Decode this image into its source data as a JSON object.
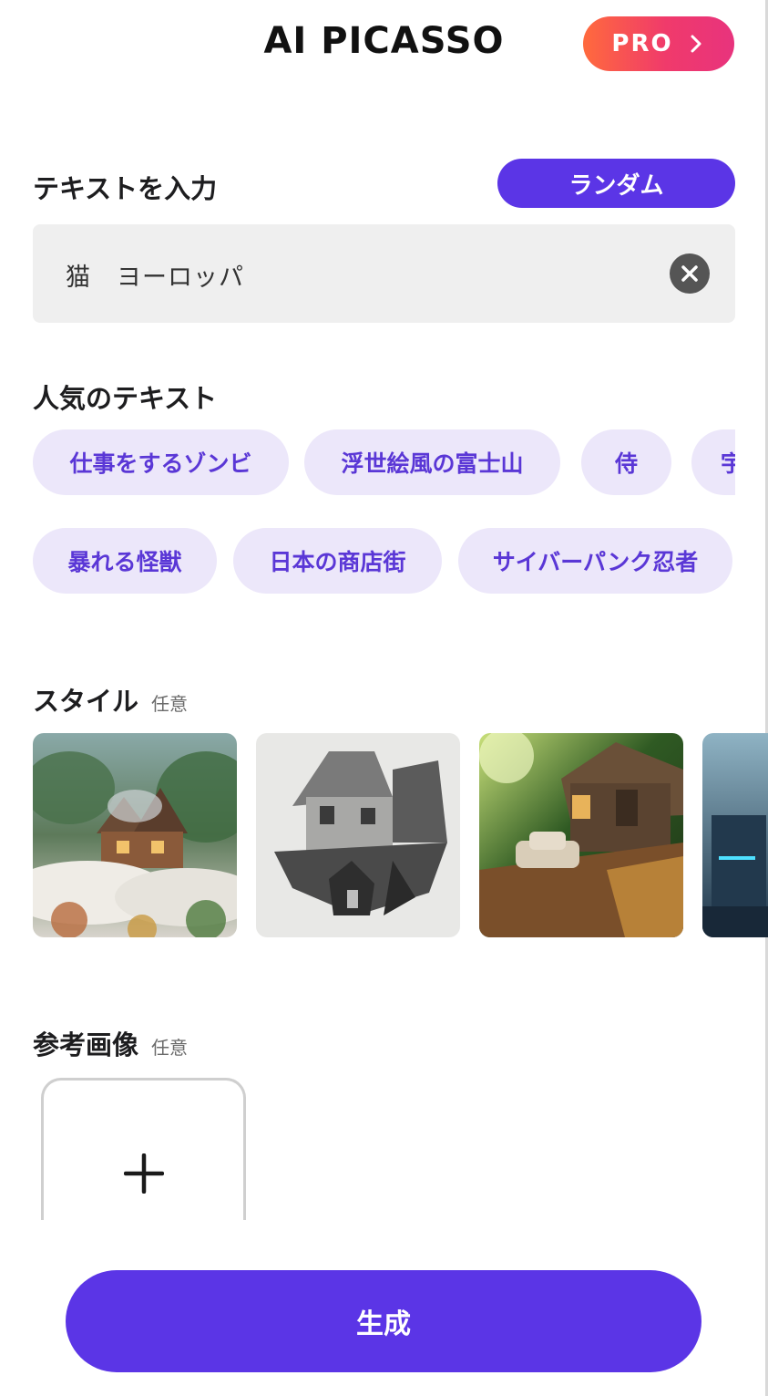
{
  "header": {
    "app_title": "AI PICASSO",
    "pro_label": "PRO",
    "pro_icon": "chevron-right-icon",
    "pro_gradient": [
      "#ff6a3d",
      "#e8337d"
    ]
  },
  "text_section": {
    "label": "テキストを入力",
    "random_label": "ランダム",
    "input_value": "猫　ヨーロッパ",
    "clear_icon": "clear-icon"
  },
  "popular": {
    "label": "人気のテキスト",
    "row1": [
      "仕事をするゾンビ",
      "浮世絵風の富士山",
      "侍",
      "宇"
    ],
    "row2": [
      "暴れる怪獣",
      "日本の商店街",
      "サイバーパンク忍者"
    ]
  },
  "style_section": {
    "label": "スタイル",
    "optional": "任意",
    "thumbnails": [
      "fantasy-cottage-painting",
      "pencil-sketch-cottage",
      "3d-render-cabin",
      "cyberpunk-scene"
    ]
  },
  "reference_section": {
    "label": "参考画像",
    "optional": "任意",
    "add_icon": "plus-icon"
  },
  "footer": {
    "generate_label": "生成"
  },
  "colors": {
    "accent": "#5b35e6",
    "chip_bg": "#ece7fa",
    "chip_text": "#5a37d6",
    "input_bg": "#efefef"
  }
}
